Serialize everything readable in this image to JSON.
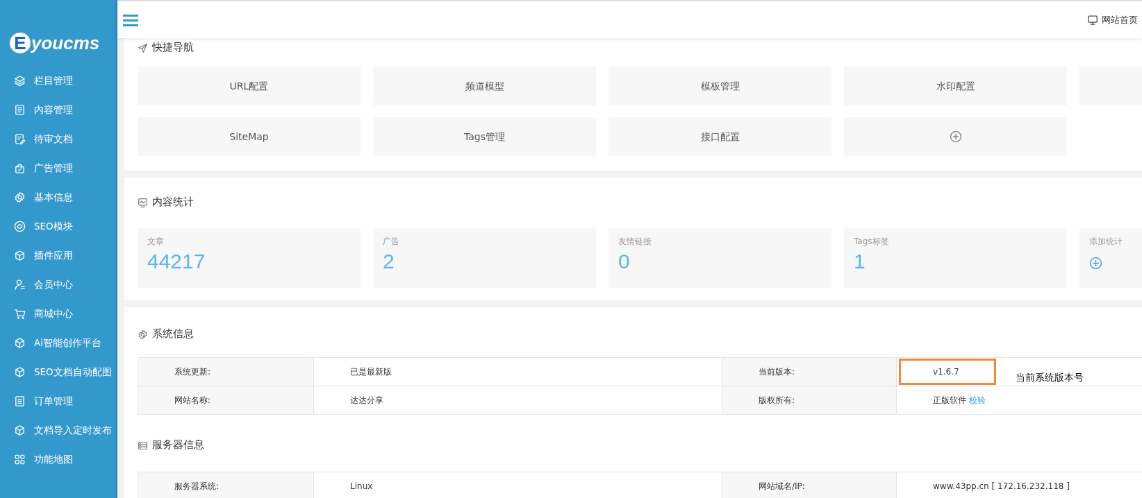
{
  "sidebar": {
    "logo_initial": "E",
    "logo_text": "youcms",
    "items": [
      {
        "label": "栏目管理"
      },
      {
        "label": "内容管理"
      },
      {
        "label": "待审文档"
      },
      {
        "label": "广告管理"
      },
      {
        "label": "基本信息"
      },
      {
        "label": "SEO模块"
      },
      {
        "label": "插件应用"
      },
      {
        "label": "会员中心"
      },
      {
        "label": "商城中心"
      },
      {
        "label": "Ai智能创作平台"
      },
      {
        "label": "SEO文档自动配图"
      },
      {
        "label": "订单管理"
      },
      {
        "label": "文档导入定时发布"
      },
      {
        "label": "功能地图"
      }
    ]
  },
  "header": {
    "home_link": "网站首页"
  },
  "quick_nav": {
    "title": "快捷导航",
    "tiles": [
      {
        "kind": "link",
        "label": "URL配置"
      },
      {
        "kind": "link",
        "label": "频道模型"
      },
      {
        "kind": "link",
        "label": "模板管理"
      },
      {
        "kind": "link",
        "label": "水印配置"
      },
      {
        "kind": "blank"
      },
      {
        "kind": "link",
        "label": "SiteMap"
      },
      {
        "kind": "link",
        "label": "Tags管理"
      },
      {
        "kind": "link",
        "label": "接口配置"
      },
      {
        "kind": "add"
      }
    ]
  },
  "content_stats": {
    "title": "内容统计",
    "items": [
      {
        "kind": "count",
        "label": "文章",
        "value": "44217"
      },
      {
        "kind": "count",
        "label": "广告",
        "value": "2"
      },
      {
        "kind": "count",
        "label": "友情链接",
        "value": "0"
      },
      {
        "kind": "count",
        "label": "Tags标签",
        "value": "1"
      },
      {
        "kind": "add",
        "label": "添加统计"
      }
    ]
  },
  "system_info": {
    "title": "系统信息",
    "rows": [
      [
        {
          "text": "系统更新:"
        },
        {
          "text": "已是最新版"
        },
        {
          "text": "当前版本:"
        },
        {
          "text": "v1.6.7",
          "highlighted": true,
          "annotation": "当前系统版本号"
        }
      ],
      [
        {
          "text": "网站名称:"
        },
        {
          "text": "达达分享"
        },
        {
          "text": "版权所有:"
        },
        {
          "text": "正版软件",
          "link": "校验"
        }
      ]
    ]
  },
  "server_info": {
    "title": "服务器信息",
    "rows": [
      [
        {
          "text": "服务器系统:"
        },
        {
          "text": "Linux"
        },
        {
          "text": "网站域名/IP:"
        },
        {
          "text": "www.43pp.cn [ 172.16.232.118 ]"
        }
      ]
    ]
  }
}
